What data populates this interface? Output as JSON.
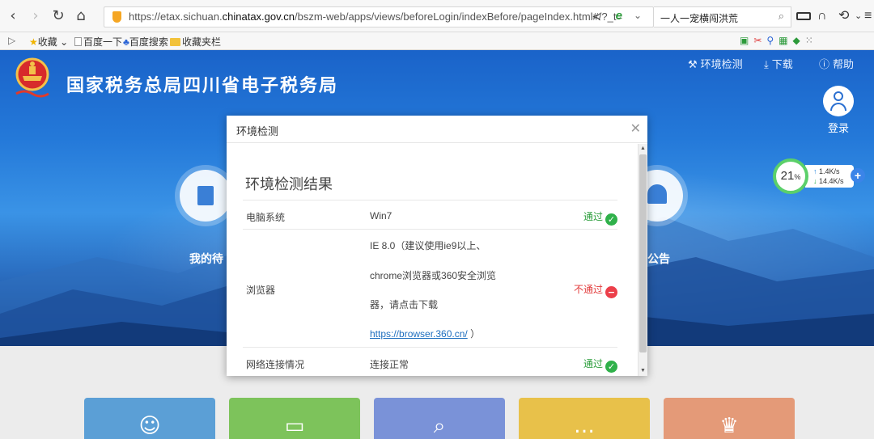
{
  "browser": {
    "url_prefix": "https://etax.sichuan.",
    "url_domain": "chinatax.gov.cn",
    "url_suffix": "/bszm-web/apps/views/beforeLogin/indexBefore/pageIndex.html#/?_t=",
    "search_text": "一人一宠横闯洪荒",
    "bookmarks": {
      "favorites": "收藏",
      "baidu_once": "百度一下",
      "baidu_search": "百度搜索",
      "bookmark_bar": "收藏夹栏"
    }
  },
  "site": {
    "title": "国家税务总局四川省电子税务局",
    "env_check": "环境检测",
    "download": "下载",
    "help": "帮助",
    "login": "登录",
    "feature_left_label": "我的待",
    "feature_right_label": "公告"
  },
  "speed_widget": {
    "percent": "21",
    "percent_unit": "%",
    "upload": "1.4K/s",
    "download": "14.4K/s"
  },
  "dialog": {
    "title": "环境检测",
    "heading": "环境检测结果",
    "rows": [
      {
        "label": "电脑系统",
        "value": "Win7",
        "status": "通过"
      },
      {
        "label": "浏览器",
        "value_line1": "IE 8.0（建议使用ie9以上、",
        "value_line2": "chrome浏览器或360安全浏览",
        "value_line3": "器，请点击下载",
        "link": "https://browser.360.cn/",
        "link_suffix": "）",
        "status": "不通过"
      },
      {
        "label": "网络连接情况",
        "value": "连接正常",
        "status": "通过"
      }
    ]
  },
  "colors": {
    "pass": "#2fb14a",
    "fail": "#ec3f4a",
    "tile_colors": [
      "#5b9fd6",
      "#7dc35b",
      "#7a92d8",
      "#e8c14a",
      "#e49a78"
    ]
  }
}
